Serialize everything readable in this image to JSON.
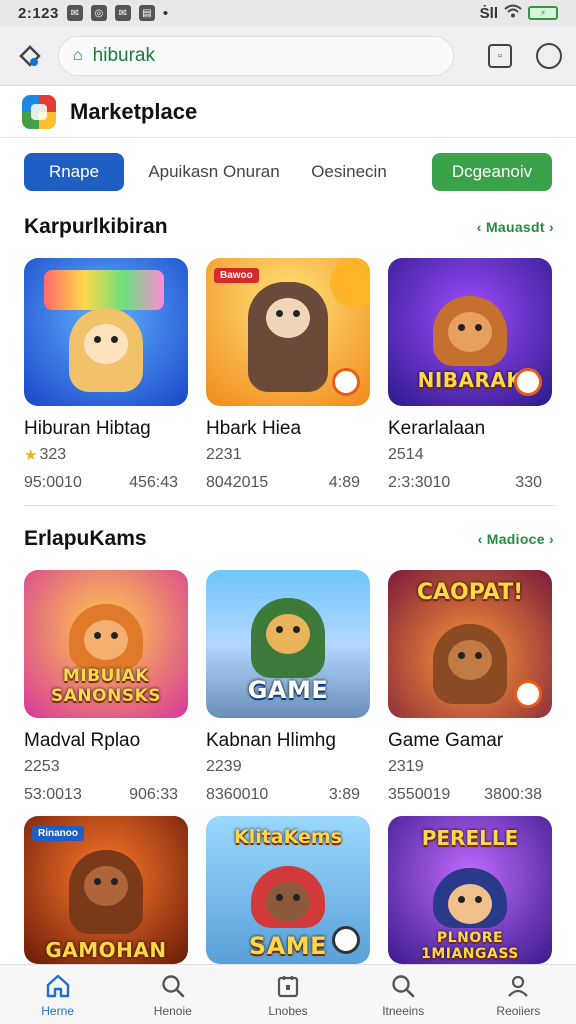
{
  "status_bar": {
    "time": "2:123",
    "right_text": "Ṡll"
  },
  "browser": {
    "url": "hiburak"
  },
  "app": {
    "title": "Marketplace"
  },
  "chips": [
    {
      "label": "Rnape",
      "style": "active"
    },
    {
      "label": "Apuikasn Onuran",
      "style": "plain"
    },
    {
      "label": "Oesinecin",
      "style": "plain"
    },
    {
      "label": "Dcgeanoiv",
      "style": "green"
    }
  ],
  "sections": [
    {
      "title": "Karpurlkibiran",
      "see_more": "‹ Mauasdt ›",
      "cards": [
        {
          "name": "Hiburan Hibtag",
          "rating": "323",
          "meta_left": "95:0010",
          "meta_right": "456:43",
          "thumb_text": "",
          "thumb_tag": ""
        },
        {
          "name": "Hbark Hiea",
          "rating": "2231",
          "meta_left": "8042015",
          "meta_right": "4:89",
          "thumb_text": "",
          "thumb_tag": "Bawoo"
        },
        {
          "name": "Kerarlalaan",
          "rating": "2514",
          "meta_left": "2:3:3010",
          "meta_right": "330",
          "thumb_text": "NIBARAK",
          "thumb_tag": ""
        }
      ]
    },
    {
      "title": "ErlapuKams",
      "see_more": "‹ Madioce ›",
      "cards": [
        {
          "name": "Madval Rplao",
          "rating": "2253",
          "meta_left": "53:0013",
          "meta_right": "906:33",
          "thumb_text": "MIBUIAK SANONSKS",
          "thumb_tag": ""
        },
        {
          "name": "Kabnan Hlimhg",
          "rating": "2239",
          "meta_left": "8360010",
          "meta_right": "3:89",
          "thumb_text": "GAME",
          "thumb_tag": ""
        },
        {
          "name": "Game Gamar",
          "rating": "2319",
          "meta_left": "3550019",
          "meta_right": "3800:38",
          "thumb_text": "CAOPAT!",
          "thumb_tag": ""
        }
      ]
    },
    {
      "cards": [
        {
          "thumb_text": "GAMOHAN",
          "thumb_tag": "Rinanoo"
        },
        {
          "thumb_text": "SAME",
          "thumb_top": "KlitaKems"
        },
        {
          "thumb_text": "PLNORE 1MIANGASS",
          "thumb_top": "PERELLE"
        }
      ]
    }
  ],
  "bottom_nav": [
    {
      "label": "Herne",
      "icon": "home-icon",
      "active": true
    },
    {
      "label": "Henoie",
      "icon": "search-icon",
      "active": false
    },
    {
      "label": "Lnobes",
      "icon": "calendar-icon",
      "active": false
    },
    {
      "label": "Itneeins",
      "icon": "search-icon",
      "active": false
    },
    {
      "label": "Reoiiers",
      "icon": "profile-icon",
      "active": false
    }
  ]
}
